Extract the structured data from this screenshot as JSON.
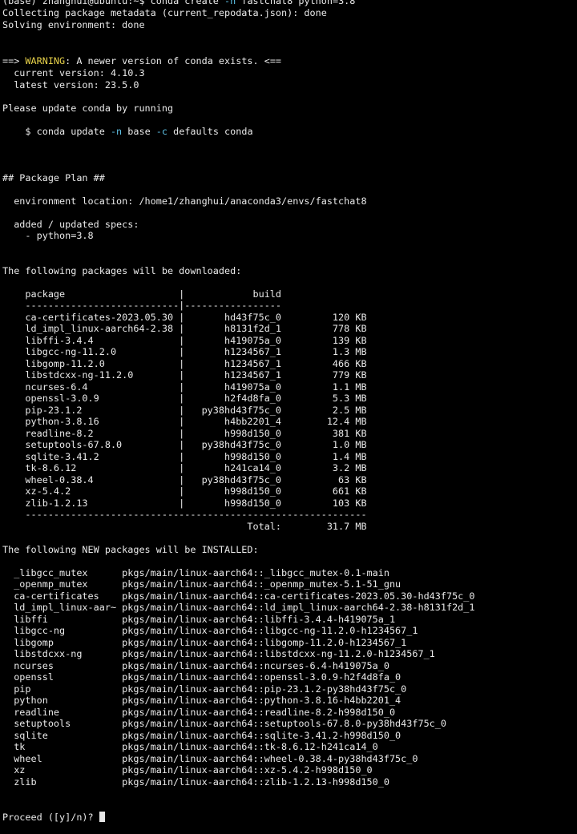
{
  "prompt": "(base) zhanghui@ubuntu:~$ ",
  "command": {
    "main": "conda create ",
    "flag": "-n",
    "rest": " fastchat8 python=3.8"
  },
  "collecting": "Collecting package metadata (current_repodata.json): done",
  "solving": "Solving environment: done",
  "warning": {
    "arrow": "==> ",
    "label": "WARNING",
    "message": ": A newer version of conda exists. <==",
    "current": "  current version: 4.10.3",
    "latest": "  latest version: 23.5.0"
  },
  "update_notice": "Please update conda by running",
  "update_cmd": {
    "prefix": "    $ conda update ",
    "flag_n": "-n",
    "mid": " base ",
    "flag_c": "-c",
    "suffix": " defaults conda"
  },
  "plan_header": "## Package Plan ##",
  "env_location": "  environment location: /home1/zhanghui/anaconda3/envs/fastchat8",
  "specs_header": "  added / updated specs:",
  "spec_item": "    - python=3.8",
  "download_header": "The following packages will be downloaded:",
  "download_table": {
    "header": "    package                    |            build",
    "separator": "    ---------------------------|-----------------",
    "rows": [
      "    ca-certificates-2023.05.30 |       hd43f75c_0         120 KB",
      "    ld_impl_linux-aarch64-2.38 |       h8131f2d_1         778 KB",
      "    libffi-3.4.4               |       h419075a_0         139 KB",
      "    libgcc-ng-11.2.0           |       h1234567_1         1.3 MB",
      "    libgomp-11.2.0             |       h1234567_1         466 KB",
      "    libstdcxx-ng-11.2.0        |       h1234567_1         779 KB",
      "    ncurses-6.4                |       h419075a_0         1.1 MB",
      "    openssl-3.0.9              |       h2f4d8fa_0         5.3 MB",
      "    pip-23.1.2                 |   py38hd43f75c_0         2.5 MB",
      "    python-3.8.16              |       h4bb2201_4        12.4 MB",
      "    readline-8.2               |       h998d150_0         381 KB",
      "    setuptools-67.8.0          |   py38hd43f75c_0         1.0 MB",
      "    sqlite-3.41.2              |       h998d150_0         1.4 MB",
      "    tk-8.6.12                  |       h241ca14_0         3.2 MB",
      "    wheel-0.38.4               |   py38hd43f75c_0          63 KB",
      "    xz-5.4.2                   |       h998d150_0         661 KB",
      "    zlib-1.2.13                |       h998d150_0         103 KB"
    ],
    "footer_rule": "    ------------------------------------------------------------",
    "total": "                                           Total:        31.7 MB"
  },
  "install_header": "The following NEW packages will be INSTALLED:",
  "install_rows": [
    "  _libgcc_mutex      pkgs/main/linux-aarch64::_libgcc_mutex-0.1-main",
    "  _openmp_mutex      pkgs/main/linux-aarch64::_openmp_mutex-5.1-51_gnu",
    "  ca-certificates    pkgs/main/linux-aarch64::ca-certificates-2023.05.30-hd43f75c_0",
    "  ld_impl_linux-aar~ pkgs/main/linux-aarch64::ld_impl_linux-aarch64-2.38-h8131f2d_1",
    "  libffi             pkgs/main/linux-aarch64::libffi-3.4.4-h419075a_1",
    "  libgcc-ng          pkgs/main/linux-aarch64::libgcc-ng-11.2.0-h1234567_1",
    "  libgomp            pkgs/main/linux-aarch64::libgomp-11.2.0-h1234567_1",
    "  libstdcxx-ng       pkgs/main/linux-aarch64::libstdcxx-ng-11.2.0-h1234567_1",
    "  ncurses            pkgs/main/linux-aarch64::ncurses-6.4-h419075a_0",
    "  openssl            pkgs/main/linux-aarch64::openssl-3.0.9-h2f4d8fa_0",
    "  pip                pkgs/main/linux-aarch64::pip-23.1.2-py38hd43f75c_0",
    "  python             pkgs/main/linux-aarch64::python-3.8.16-h4bb2201_4",
    "  readline           pkgs/main/linux-aarch64::readline-8.2-h998d150_0",
    "  setuptools         pkgs/main/linux-aarch64::setuptools-67.8.0-py38hd43f75c_0",
    "  sqlite             pkgs/main/linux-aarch64::sqlite-3.41.2-h998d150_0",
    "  tk                 pkgs/main/linux-aarch64::tk-8.6.12-h241ca14_0",
    "  wheel              pkgs/main/linux-aarch64::wheel-0.38.4-py38hd43f75c_0",
    "  xz                 pkgs/main/linux-aarch64::xz-5.4.2-h998d150_0",
    "  zlib               pkgs/main/linux-aarch64::zlib-1.2.13-h998d150_0"
  ],
  "proceed_prompt": "Proceed ([y]/n)? ",
  "colors": {
    "background": "#000000",
    "text": "#eaeaea",
    "flag": "#5fc2e6",
    "warning": "#e8d24a"
  }
}
